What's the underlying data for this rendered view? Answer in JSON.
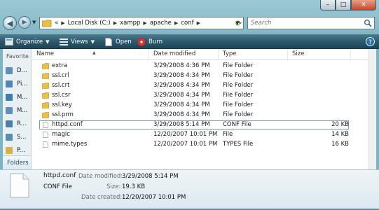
{
  "window": {
    "controls": {
      "minimize": "–",
      "maximize": "□",
      "close": "✕"
    }
  },
  "address_bar": {
    "overflow": "«",
    "crumbs": [
      "Local Disk (C:)",
      "xampp",
      "apache",
      "conf"
    ]
  },
  "search": {
    "placeholder": "Search"
  },
  "toolbar": {
    "organize": "Organize",
    "views": "Views",
    "open": "Open",
    "burn": "Burn"
  },
  "left_pane": {
    "favorites_label": "Favorite",
    "items": [
      {
        "label": "D...",
        "icon": "documents-icon",
        "color": "#5d8fb7"
      },
      {
        "label": "Pi...",
        "icon": "pictures-icon",
        "color": "#4f86b4"
      },
      {
        "label": "M...",
        "icon": "music-icon",
        "color": "#3e7ea8"
      },
      {
        "label": "M...",
        "icon": "more-icon",
        "color": "#5d8fb7"
      },
      {
        "label": "R...",
        "icon": "recent-icon",
        "color": "#4b7fa6"
      },
      {
        "label": "S...",
        "icon": "searches-icon",
        "color": "#5a8cb0"
      },
      {
        "label": "P...",
        "icon": "public-icon",
        "color": "#d4b24a"
      }
    ],
    "folders_label": "Folders"
  },
  "columns": [
    "Name",
    "Date modified",
    "Type",
    "Size"
  ],
  "files": [
    {
      "name": "extra",
      "date": "3/29/2008 4:36 PM",
      "type": "File Folder",
      "size": "",
      "kind": "folder"
    },
    {
      "name": "ssl.crl",
      "date": "3/29/2008 4:34 PM",
      "type": "File Folder",
      "size": "",
      "kind": "folder"
    },
    {
      "name": "ssl.crt",
      "date": "3/29/2008 4:34 PM",
      "type": "File Folder",
      "size": "",
      "kind": "folder"
    },
    {
      "name": "ssl.csr",
      "date": "3/29/2008 4:34 PM",
      "type": "File Folder",
      "size": "",
      "kind": "folder"
    },
    {
      "name": "ssl.key",
      "date": "3/29/2008 4:34 PM",
      "type": "File Folder",
      "size": "",
      "kind": "folder"
    },
    {
      "name": "ssl.prm",
      "date": "3/29/2008 4:34 PM",
      "type": "File Folder",
      "size": "",
      "kind": "folder"
    },
    {
      "name": "httpd.conf",
      "date": "3/29/2008 5:14 PM",
      "type": "CONF File",
      "size": "20 KB",
      "kind": "file",
      "selected": true
    },
    {
      "name": "magic",
      "date": "12/20/2007 10:01 PM",
      "type": "File",
      "size": "14 KB",
      "kind": "file"
    },
    {
      "name": "mime.types",
      "date": "12/20/2007 10:01 PM",
      "type": "TYPES File",
      "size": "16 KB",
      "kind": "file"
    }
  ],
  "details": {
    "name": "httpd.conf",
    "type": "CONF File",
    "date_modified_label": "Date modified:",
    "date_modified": "3/29/2008 5:14 PM",
    "size_label": "Size:",
    "size": "19.3 KB",
    "date_created_label": "Date created:",
    "date_created": "12/20/2007 10:01 PM"
  },
  "colors": {
    "folder": "#e8c04a",
    "toolbar": "#2b5568",
    "selection_border": "#7a9bb0"
  }
}
